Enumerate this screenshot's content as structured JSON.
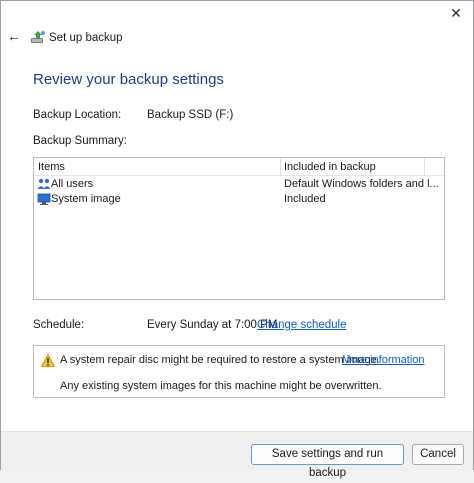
{
  "window": {
    "title": "Set up backup",
    "close_glyph": "✕",
    "back_glyph": "←"
  },
  "heading": "Review your backup settings",
  "location": {
    "label": "Backup Location:",
    "value": "Backup SSD (F:)"
  },
  "summary": {
    "label": "Backup Summary:",
    "columns": [
      "Items",
      "Included in backup"
    ],
    "rows": [
      {
        "item": "All users",
        "included": "Default Windows folders and l...",
        "icon": "users-icon"
      },
      {
        "item": "System image",
        "included": "Included",
        "icon": "monitor-icon"
      }
    ]
  },
  "schedule": {
    "label": "Schedule:",
    "value": "Every Sunday at 7:00 PM",
    "link": "Change schedule"
  },
  "notice": {
    "line1": "A system repair disc might be required to restore a system image.",
    "link": "More information",
    "line2": "Any existing system images for this machine might be overwritten."
  },
  "buttons": {
    "save": "Save settings and run backup",
    "cancel": "Cancel"
  },
  "colors": {
    "heading": "#1f3b87",
    "link": "#0b5cc9",
    "warning": "#f4c430"
  }
}
